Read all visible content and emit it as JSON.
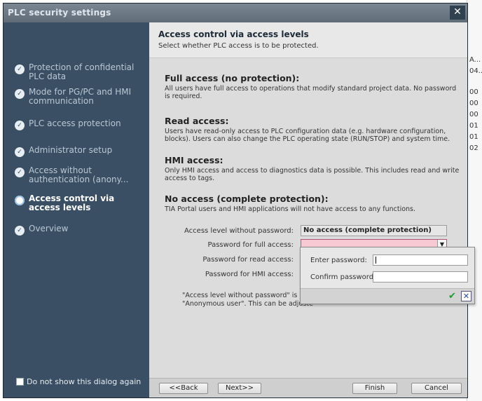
{
  "background": {
    "cells": [
      "A...",
      "04...",
      "00",
      "00",
      "00",
      "01",
      "01",
      "02"
    ]
  },
  "dialog": {
    "title": "PLC security settings",
    "close_glyph": "✕"
  },
  "sidebar": {
    "items": [
      {
        "label": "Protection of confidential PLC data",
        "active": false
      },
      {
        "label": "Mode for PG/PC and HMI communication",
        "active": false
      },
      {
        "label": "PLC access protection",
        "active": false
      },
      {
        "label": "Administrator setup",
        "active": false
      },
      {
        "label": "Access without authentication (anony...",
        "active": false
      },
      {
        "label": "Access control via access levels",
        "active": true
      },
      {
        "label": "Overview",
        "active": false
      }
    ],
    "dont_show_label": "Do not show this dialog again"
  },
  "main": {
    "heading": "Access control via access levels",
    "subheading": "Select whether PLC access is to be protected.",
    "sections": [
      {
        "title": "Full access (no protection):",
        "desc": "All users have full access to operations that modify standard project data. No password is required."
      },
      {
        "title": "Read access:",
        "desc": "Users have read-only access to PLC configuration data (e.g. hardware configuration, blocks). Users can also change the PLC operating state (RUN/STOP) and system time."
      },
      {
        "title": "HMI access:",
        "desc": "Only HMI access and access to diagnostics data is possible. This includes read and write access to tags."
      },
      {
        "title": "No access (complete protection):",
        "desc": "TIA Portal users and HMI applications will not have access to any functions."
      }
    ],
    "form": {
      "no_password_label": "Access level without password:",
      "no_password_value": "No access (complete protection)",
      "full_access_label": "Password for full access:",
      "read_access_label": "Password for read access:",
      "hmi_access_label": "Password for HMI access:"
    },
    "note_line1": "\"Access level without password\" is co",
    "note_line2": "\"Anonymous user\". This can be adjuste"
  },
  "popup": {
    "enter_label": "Enter password:",
    "confirm_label": "Confirm password:",
    "ok_glyph": "✔",
    "cancel_glyph": "✕"
  },
  "buttons": {
    "back": "<<Back",
    "next": "Next>>",
    "finish": "Finish",
    "cancel": "Cancel"
  }
}
